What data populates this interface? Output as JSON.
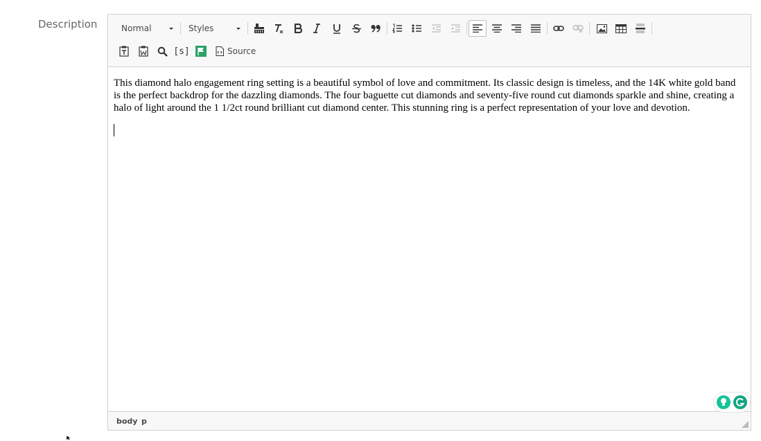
{
  "field": {
    "label": "Description"
  },
  "toolbar": {
    "format_value": "Normal",
    "styles_value": "Styles",
    "source_label": "Source",
    "icons": [
      "paint-format-icon",
      "remove-format-icon",
      "bold-icon",
      "italic-icon",
      "underline-icon",
      "strikethrough-icon",
      "blockquote-icon",
      "numbered-list-icon",
      "bulleted-list-icon",
      "outdent-icon",
      "indent-icon",
      "align-left-icon",
      "align-center-icon",
      "align-right-icon",
      "justify-icon",
      "link-icon",
      "unlink-icon",
      "image-icon",
      "table-icon",
      "horizontal-line-icon",
      "paste-text-icon",
      "paste-word-icon",
      "find-icon",
      "placeholder-icon",
      "flag-icon",
      "source-icon"
    ],
    "placeholder_glyph": "[s]"
  },
  "content": {
    "paragraph": "This diamond halo engagement ring setting is a beautiful symbol of love and commitment. Its classic design is timeless, and the 14K white gold band is the perfect backdrop for the dazzling diamonds. The four baguette cut diamonds and seventy-five round cut diamonds sparkle and shine, creating a halo of light around the 1 1/2ct round brilliant cut diamond center. This stunning ring is a perfect representation of your love and devotion."
  },
  "statusbar": {
    "path": [
      "body",
      "p"
    ]
  },
  "colors": {
    "flag_green": "#2aa267",
    "grammarly_green": "#15c39a",
    "grammarly_dark": "#11a683"
  }
}
